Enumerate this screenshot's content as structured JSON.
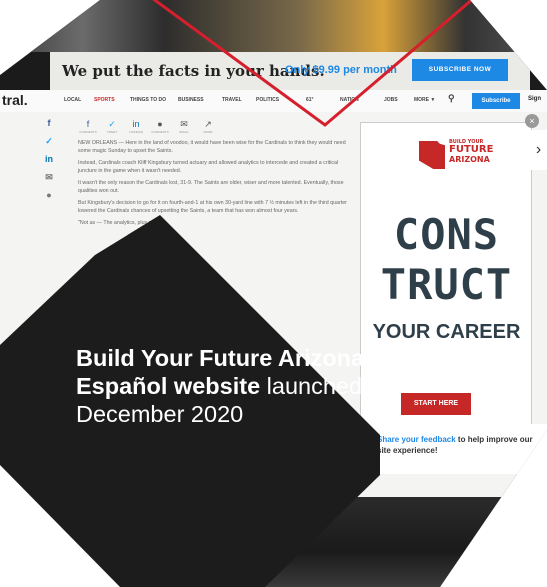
{
  "banner": {
    "headline": "We put the facts in your hands.",
    "price": "Only $9.99 per month",
    "subscribe_button": "SUBSCRIBE NOW"
  },
  "navbar": {
    "logo": "tral.",
    "items": [
      "LOCAL",
      "SPORTS",
      "THINGS TO DO",
      "BUSINESS",
      "TRAVEL",
      "POLITICS",
      "61°",
      "NATION",
      "JOBS",
      "MORE ▼"
    ],
    "subscribe": "Subscribe",
    "signin": "Sign"
  },
  "share": {
    "labels": [
      "COMMENTS",
      "TWEET",
      "LINKEDIN",
      "COMMENTS",
      "EMAIL",
      "MORE"
    ]
  },
  "article": {
    "paragraphs": [
      "NEW ORLEANS — Here in the land of voodoo, it would have been wise for the Cardinals to think they would need some magic Sunday to upset the Saints.",
      "Instead, Cardinals coach Kliff Kingsbury turned actuary and allowed analytics to intercede and created a critical juncture in the game when it wasn't needed.",
      "It wasn't the only reason the Cardinals lost, 31-9. The Saints are older, wiser and more talented. Eventually, those qualities won out.",
      "But Kingsbury's decision to go for it on fourth-and-1 at his own 30-yard line with 7 ½ minutes left in the third quarter lowered the Cardinals chances of upsetting the Saints, a team that has won almost four years.",
      "\"Not as — The analytics, plus my..."
    ]
  },
  "ad": {
    "logo_line1": "BUILD YOUR",
    "logo_line2": "FUTURE",
    "logo_line3": "ARIZONA",
    "line1": "CONS",
    "line2": "TRUCT",
    "line3": "YOUR CAREER",
    "cta": "START HERE"
  },
  "feedback": {
    "link": "Share your feedback",
    "rest": " to help improve our site experience!"
  },
  "caption": {
    "bold": "Build Your Future Arizona Español website",
    "regular": " launched December 2020"
  },
  "colors": {
    "accent_blue": "#1e88e5",
    "ad_red": "#c62828",
    "caption_bg": "#1c1c1c",
    "chevron_red": "#d61f2c"
  }
}
